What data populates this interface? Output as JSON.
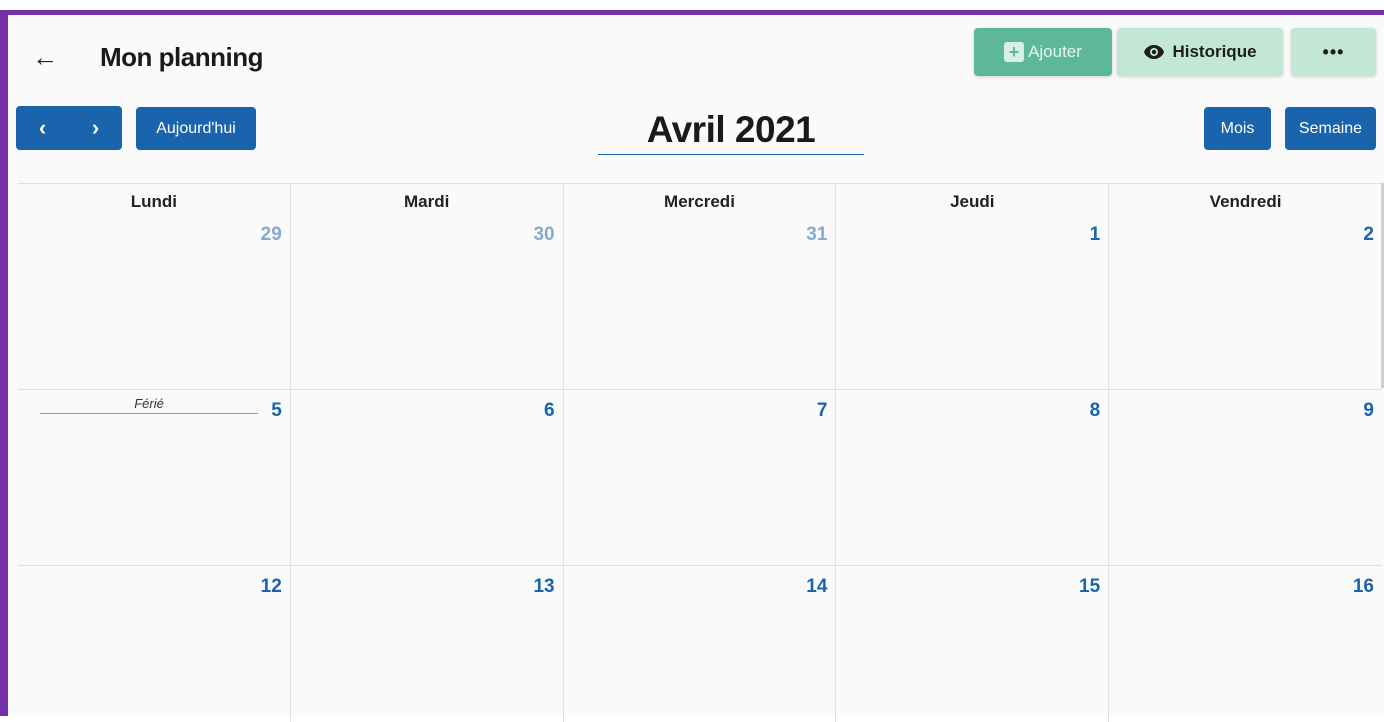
{
  "header": {
    "title": "Mon planning",
    "add_label": "Ajouter",
    "history_label": "Historique",
    "more_label": "•••"
  },
  "toolbar": {
    "prev_icon": "chevron-left",
    "next_icon": "chevron-right",
    "today_label": "Aujourd'hui",
    "month_title": "Avril 2021",
    "month_view_label": "Mois",
    "week_view_label": "Semaine"
  },
  "colors": {
    "accent": "#1a63ad",
    "frame": "#7430a8",
    "add_button": "#5cb896",
    "history_button": "#c3e7d5"
  },
  "calendar": {
    "days_of_week": [
      "Lundi",
      "Mardi",
      "Mercredi",
      "Jeudi",
      "Vendredi"
    ],
    "weeks": [
      {
        "days": [
          {
            "num": "29",
            "other_month": true
          },
          {
            "num": "30",
            "other_month": true
          },
          {
            "num": "31",
            "other_month": true
          },
          {
            "num": "1",
            "other_month": false
          },
          {
            "num": "2",
            "other_month": false
          }
        ]
      },
      {
        "days": [
          {
            "num": "5",
            "other_month": false,
            "event": "Férié"
          },
          {
            "num": "6",
            "other_month": false
          },
          {
            "num": "7",
            "other_month": false
          },
          {
            "num": "8",
            "other_month": false
          },
          {
            "num": "9",
            "other_month": false
          }
        ]
      },
      {
        "days": [
          {
            "num": "12",
            "other_month": false
          },
          {
            "num": "13",
            "other_month": false
          },
          {
            "num": "14",
            "other_month": false
          },
          {
            "num": "15",
            "other_month": false
          },
          {
            "num": "16",
            "other_month": false
          }
        ]
      }
    ]
  }
}
